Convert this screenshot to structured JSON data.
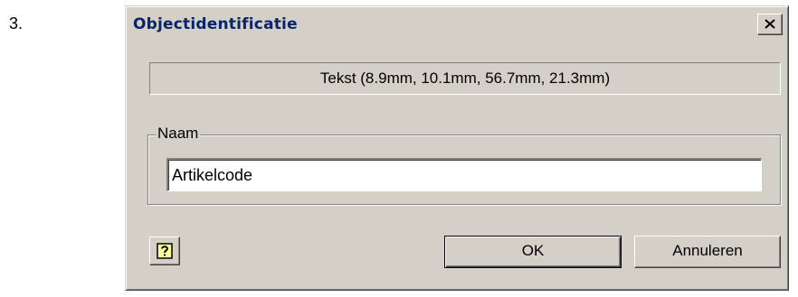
{
  "step": {
    "number": "3."
  },
  "dialog": {
    "title": "Objectidentificatie",
    "close_icon": "close-icon",
    "info_text": "Tekst (8.9mm, 10.1mm, 56.7mm, 21.3mm)",
    "name_group": {
      "label": "Naam",
      "value": "Artikelcode"
    },
    "help_icon": "help-icon",
    "ok_label": "OK",
    "cancel_label": "Annuleren"
  },
  "colors": {
    "dialog_bg": "#d4d0c8",
    "title_text": "#0a246a",
    "help_icon_fill": "#ffff99"
  }
}
